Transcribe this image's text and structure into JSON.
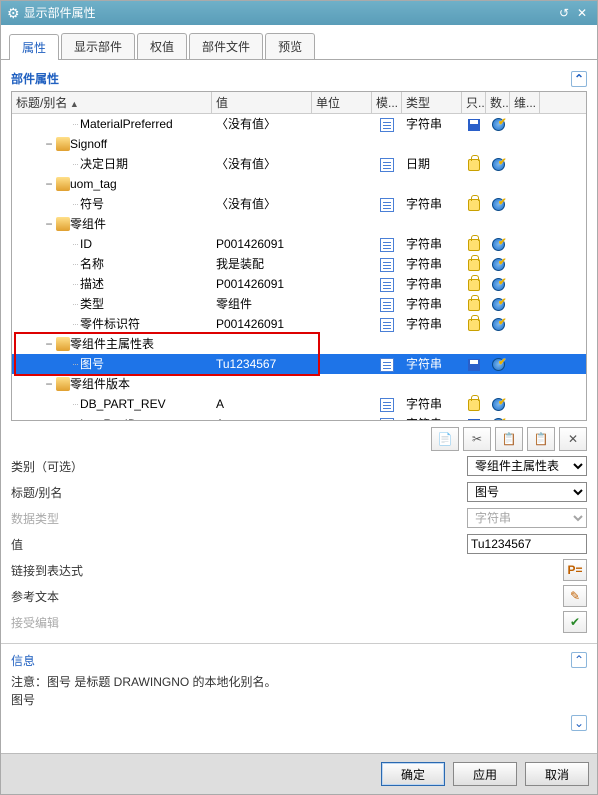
{
  "titlebar": {
    "gear": "⚙",
    "title": "显示部件属性",
    "reset": "↺",
    "close": "✕"
  },
  "tabs": [
    {
      "label": "属性",
      "active": true
    },
    {
      "label": "显示部件"
    },
    {
      "label": "权值"
    },
    {
      "label": "部件文件"
    },
    {
      "label": "预览"
    }
  ],
  "section1_title": "部件属性",
  "columns": {
    "name": "标题/别名",
    "value": "值",
    "unit": "单位",
    "mo": "模...",
    "type": "类型",
    "only": "只...",
    "count": "数...",
    "dim": "维..."
  },
  "rows": [
    {
      "level": 2,
      "exp": "",
      "icon": "",
      "name": "MaterialPreferred",
      "value": "〈没有值〉",
      "doc": true,
      "type": "字符串",
      "iA": "save",
      "iB": "globe"
    },
    {
      "level": 1,
      "exp": "−",
      "icon": "folder",
      "name": "Signoff",
      "group": true
    },
    {
      "level": 2,
      "exp": "",
      "icon": "",
      "name": "决定日期",
      "value": "〈没有值〉",
      "doc": true,
      "type": "日期",
      "iA": "lock",
      "iB": "globe"
    },
    {
      "level": 1,
      "exp": "−",
      "icon": "folder",
      "name": "uom_tag",
      "group": true
    },
    {
      "level": 2,
      "exp": "",
      "icon": "",
      "name": "符号",
      "value": "〈没有值〉",
      "doc": true,
      "type": "字符串",
      "iA": "lock",
      "iB": "globe"
    },
    {
      "level": 1,
      "exp": "−",
      "icon": "folder",
      "name": "零组件",
      "group": true
    },
    {
      "level": 2,
      "exp": "",
      "icon": "",
      "name": "ID",
      "value": "P001426091",
      "doc": true,
      "type": "字符串",
      "iA": "lock",
      "iB": "globe"
    },
    {
      "level": 2,
      "exp": "",
      "icon": "",
      "name": "名称",
      "value": "我是装配",
      "doc": true,
      "type": "字符串",
      "iA": "lock",
      "iB": "globe"
    },
    {
      "level": 2,
      "exp": "",
      "icon": "",
      "name": "描述",
      "value": "P001426091",
      "doc": true,
      "type": "字符串",
      "iA": "lock",
      "iB": "globe"
    },
    {
      "level": 2,
      "exp": "",
      "icon": "",
      "name": "类型",
      "value": "零组件",
      "doc": true,
      "type": "字符串",
      "iA": "lock",
      "iB": "globe"
    },
    {
      "level": 2,
      "exp": "",
      "icon": "",
      "name": "零件标识符",
      "value": "P001426091",
      "doc": true,
      "type": "字符串",
      "iA": "lock",
      "iB": "globe"
    },
    {
      "level": 1,
      "exp": "−",
      "icon": "folder",
      "name": "零组件主属性表",
      "group": true,
      "hl": true
    },
    {
      "level": 2,
      "exp": "",
      "icon": "",
      "name": "图号",
      "value": "Tu1234567",
      "doc": true,
      "type": "字符串",
      "iA": "save",
      "iB": "globe",
      "sel": true,
      "hl": true
    },
    {
      "level": 1,
      "exp": "−",
      "icon": "folder",
      "name": "零组件版本",
      "group": true
    },
    {
      "level": 2,
      "exp": "",
      "icon": "",
      "name": "DB_PART_REV",
      "value": "A",
      "doc": true,
      "type": "字符串",
      "iA": "lock",
      "iB": "globe"
    },
    {
      "level": 2,
      "exp": "",
      "icon": "",
      "name": "ItemRevID",
      "value": "A",
      "doc": true,
      "type": "字符串",
      "iA": "save",
      "iB": "globe"
    }
  ],
  "toolbar2": {
    "copy": "📄",
    "cut": "✂",
    "pasteA": "📋",
    "pasteB": "📋",
    "delete": "✕"
  },
  "form": {
    "category_label": "类别（可选）",
    "category_value": "零组件主属性表",
    "alias_label": "标题/别名",
    "alias_value": "图号",
    "dtype_label": "数据类型",
    "dtype_value": "字符串",
    "value_label": "值",
    "value_value": "Tu1234567",
    "link_label": "链接到表达式",
    "link_btn": "P=",
    "ref_label": "参考文本",
    "ref_btn": "✎",
    "accept_label": "接受编辑",
    "accept_btn": "✔"
  },
  "info": {
    "title": "信息",
    "line1": "注意：图号 是标题 DRAWINGNO 的本地化别名。",
    "line2": "图号"
  },
  "buttons": {
    "ok": "确定",
    "apply": "应用",
    "cancel": "取消"
  }
}
